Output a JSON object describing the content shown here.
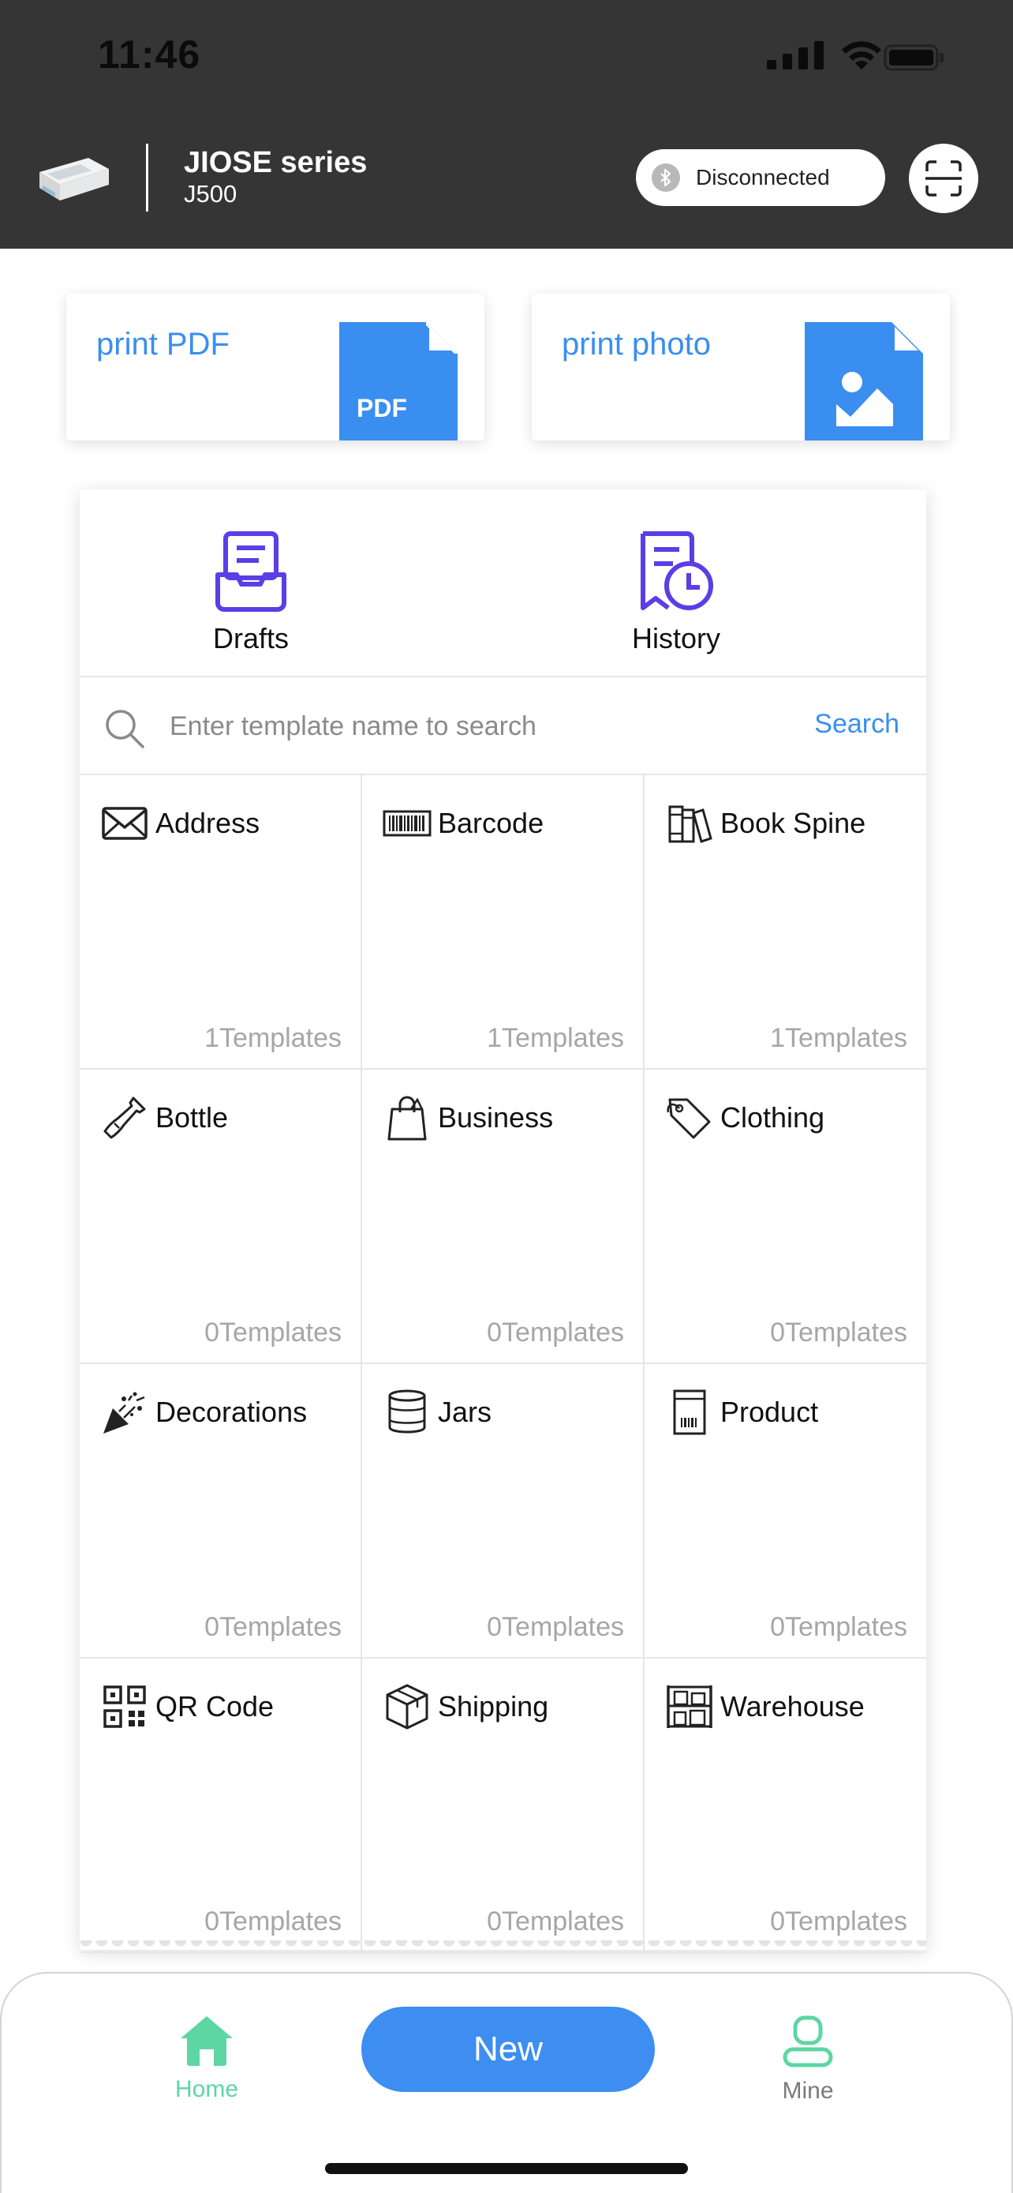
{
  "status_bar": {
    "time": "11:46"
  },
  "header": {
    "device_name": "JIOSE series",
    "device_model": "J500",
    "connection_status": "Disconnected"
  },
  "print_cards": [
    {
      "label": "print PDF",
      "icon": "pdf-file-icon",
      "badge": "PDF"
    },
    {
      "label": "print photo",
      "icon": "photo-file-icon"
    }
  ],
  "actions": [
    {
      "label": "Drafts",
      "icon": "drafts-tray-icon"
    },
    {
      "label": "History",
      "icon": "history-doc-clock-icon"
    }
  ],
  "search": {
    "placeholder": "Enter template name to search",
    "button_label": "Search"
  },
  "categories": [
    {
      "name": "Address",
      "count": "1Templates",
      "icon": "envelope-icon"
    },
    {
      "name": "Barcode",
      "count": "1Templates",
      "icon": "barcode-icon"
    },
    {
      "name": "Book Spine",
      "count": "1Templates",
      "icon": "books-icon"
    },
    {
      "name": "Bottle",
      "count": "0Templates",
      "icon": "bottle-icon"
    },
    {
      "name": "Business",
      "count": "0Templates",
      "icon": "shopping-bag-icon"
    },
    {
      "name": "Clothing",
      "count": "0Templates",
      "icon": "price-tag-icon"
    },
    {
      "name": "Decorations",
      "count": "0Templates",
      "icon": "party-popper-icon"
    },
    {
      "name": "Jars",
      "count": "0Templates",
      "icon": "jar-icon"
    },
    {
      "name": "Product",
      "count": "0Templates",
      "icon": "product-box-icon"
    },
    {
      "name": "QR Code",
      "count": "0Templates",
      "icon": "qr-code-icon"
    },
    {
      "name": "Shipping",
      "count": "0Templates",
      "icon": "package-icon"
    },
    {
      "name": "Warehouse",
      "count": "0Templates",
      "icon": "warehouse-shelves-icon"
    }
  ],
  "bottom_nav": {
    "home_label": "Home",
    "new_label": "New",
    "mine_label": "Mine"
  },
  "colors": {
    "accent_blue": "#3a8ef0",
    "purple_icon": "#5b3ee6",
    "nav_active_green": "#5dd6a4",
    "nav_inactive_gray": "#7a7a7a",
    "header_bg": "#353535"
  }
}
